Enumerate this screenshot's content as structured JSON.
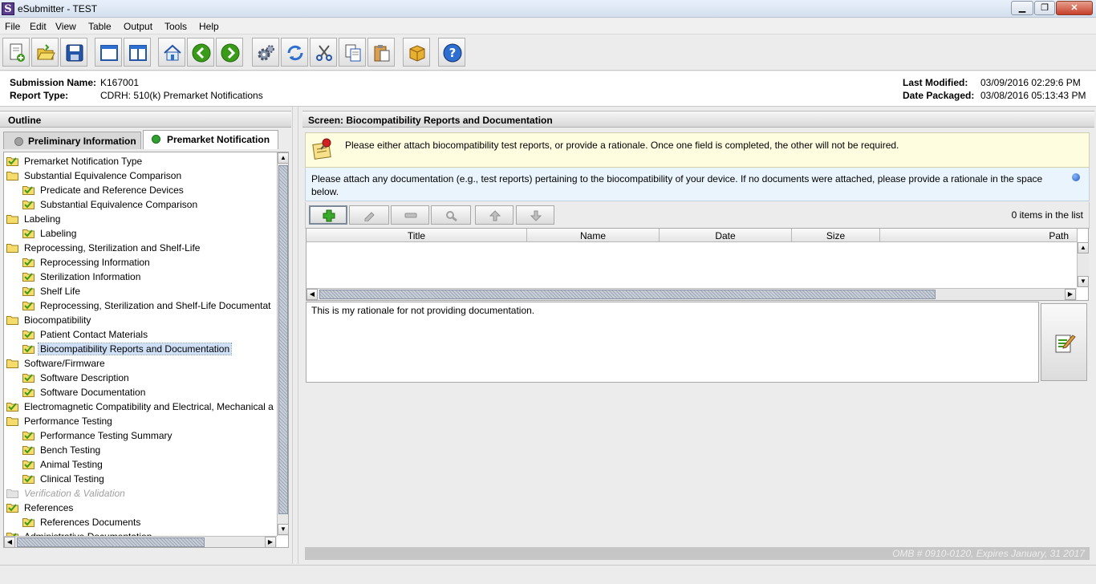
{
  "window": {
    "title": "eSubmitter - TEST",
    "app_icon_letter": "S"
  },
  "menu": [
    "File",
    "Edit",
    "View",
    "Table",
    "Output",
    "Tools",
    "Help"
  ],
  "toolbar": {
    "icons": [
      "new-document-icon",
      "open-folder-icon",
      "save-icon",
      "window-icon",
      "split-view-icon",
      "home-icon",
      "back-icon",
      "forward-icon",
      "settings-gears-icon",
      "refresh-icon",
      "cut-icon",
      "copy-icon",
      "paste-icon",
      "package-icon",
      "help-icon"
    ]
  },
  "submission": {
    "name_label": "Submission Name:",
    "name_value": "K167001",
    "type_label": "Report Type:",
    "type_value": "CDRH: 510(k) Premarket Notifications",
    "modified_label": "Last Modified:",
    "modified_value": "03/09/2016 02:29:6 PM",
    "packaged_label": "Date Packaged:",
    "packaged_value": "03/08/2016 05:13:43 PM"
  },
  "outline": {
    "header": "Outline",
    "tabs": [
      {
        "label": "Preliminary Information",
        "active": false,
        "dot_color": "#a0a0a0"
      },
      {
        "label": "Premarket Notification",
        "active": true,
        "dot_color": "#2ea12e"
      }
    ],
    "tree": [
      {
        "label": "Premarket Notification Type",
        "level": 0,
        "icon": "checked-folder-icon"
      },
      {
        "label": "Substantial Equivalence Comparison",
        "level": 0,
        "icon": "folder-icon"
      },
      {
        "label": "Predicate and Reference Devices",
        "level": 1,
        "icon": "checked-folder-icon"
      },
      {
        "label": "Substantial Equivalence Comparison",
        "level": 1,
        "icon": "checked-folder-icon"
      },
      {
        "label": "Labeling",
        "level": 0,
        "icon": "folder-icon"
      },
      {
        "label": "Labeling",
        "level": 1,
        "icon": "checked-folder-icon"
      },
      {
        "label": "Reprocessing, Sterilization and Shelf-Life",
        "level": 0,
        "icon": "folder-icon"
      },
      {
        "label": "Reprocessing Information",
        "level": 1,
        "icon": "checked-folder-icon"
      },
      {
        "label": "Sterilization Information",
        "level": 1,
        "icon": "checked-folder-icon"
      },
      {
        "label": "Shelf Life",
        "level": 1,
        "icon": "checked-folder-icon"
      },
      {
        "label": "Reprocessing, Sterilization and Shelf-Life Documentat",
        "level": 1,
        "icon": "checked-folder-icon"
      },
      {
        "label": "Biocompatibility",
        "level": 0,
        "icon": "folder-icon"
      },
      {
        "label": "Patient Contact Materials",
        "level": 1,
        "icon": "checked-folder-icon"
      },
      {
        "label": "Biocompatibility Reports and Documentation",
        "level": 1,
        "icon": "checked-folder-icon",
        "selected": true
      },
      {
        "label": "Software/Firmware",
        "level": 0,
        "icon": "folder-icon"
      },
      {
        "label": "Software Description",
        "level": 1,
        "icon": "checked-folder-icon"
      },
      {
        "label": "Software Documentation",
        "level": 1,
        "icon": "checked-folder-icon"
      },
      {
        "label": "Electromagnetic Compatibility and Electrical, Mechanical a",
        "level": 0,
        "icon": "checked-folder-icon"
      },
      {
        "label": "Performance Testing",
        "level": 0,
        "icon": "folder-icon"
      },
      {
        "label": "Performance Testing Summary",
        "level": 1,
        "icon": "checked-folder-icon"
      },
      {
        "label": "Bench Testing",
        "level": 1,
        "icon": "checked-folder-icon"
      },
      {
        "label": "Animal Testing",
        "level": 1,
        "icon": "checked-folder-icon"
      },
      {
        "label": "Clinical Testing",
        "level": 1,
        "icon": "checked-folder-icon"
      },
      {
        "label": "Verification & Validation",
        "level": 0,
        "icon": "disabled-folder-icon",
        "disabled": true
      },
      {
        "label": "References",
        "level": 0,
        "icon": "checked-folder-icon"
      },
      {
        "label": "References Documents",
        "level": 1,
        "icon": "checked-folder-icon"
      },
      {
        "label": "Administrative Documentation",
        "level": 0,
        "icon": "checked-folder-icon"
      }
    ]
  },
  "screen": {
    "header": "Screen: Biocompatibility Reports and Documentation",
    "note_text": "Please either attach biocompatibility test reports, or provide a rationale.  Once one field is completed, the other will not be required.",
    "doc_instruction_line1": "Please attach any documentation (e.g., test reports) pertaining to the biocompatibility of your device.   If no documents were attached, please provide a rationale in the space",
    "doc_instruction_line2": "below.",
    "list_toolbar_icons": [
      "add-icon",
      "edit-pencil-icon",
      "remove-icon",
      "view-magnifier-icon",
      "move-up-icon",
      "move-down-icon"
    ],
    "items_count_text": "0 items in the list",
    "columns": [
      "Title",
      "Name",
      "Date",
      "Size",
      "Path"
    ],
    "rows": [],
    "rationale_text": "This is my rationale for not providing documentation.",
    "omb_text": "OMB # 0910-0120, Expires January, 31 2017"
  },
  "colors": {
    "accent_blue": "#2d6fd0",
    "note_bg": "#fffde0",
    "instr_bg": "#eaf4fc",
    "check_green": "#3a9a1a"
  }
}
